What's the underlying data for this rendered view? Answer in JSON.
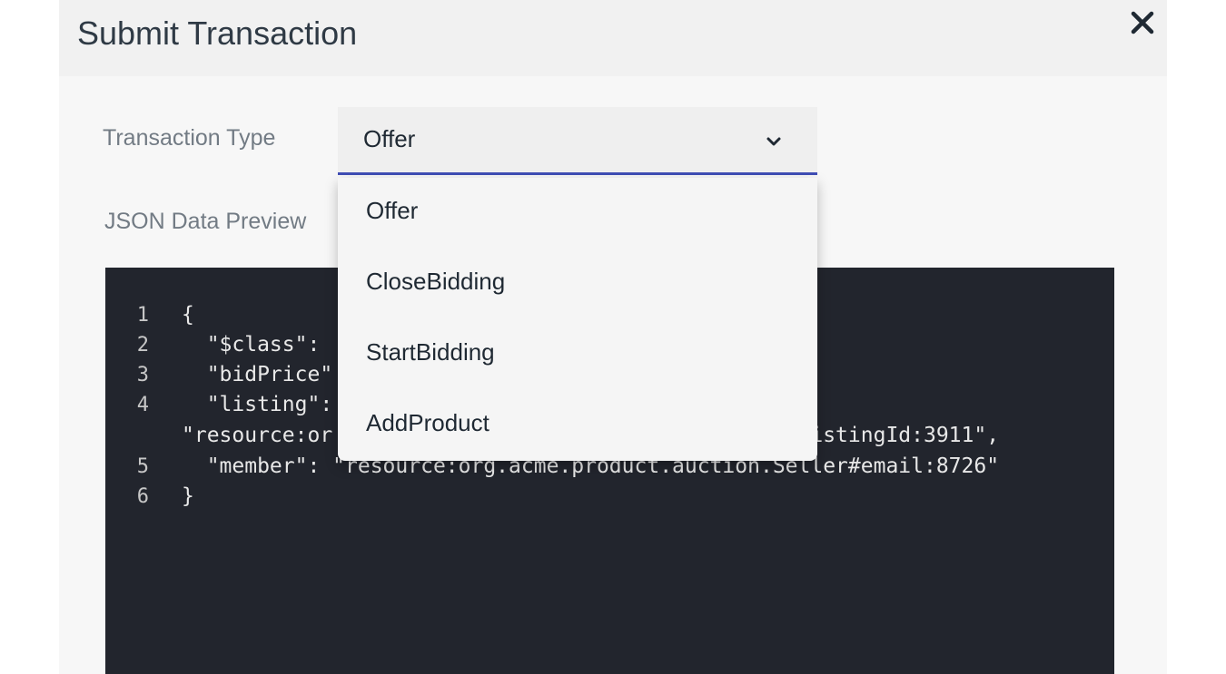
{
  "modal": {
    "title": "Submit Transaction",
    "close_icon": "close-icon"
  },
  "form": {
    "transaction_type_label": "Transaction Type",
    "selected_type": "Offer",
    "json_preview_label": "JSON Data Preview"
  },
  "dropdown": {
    "options": [
      "Offer",
      "CloseBidding",
      "StartBidding",
      "AddProduct"
    ]
  },
  "code": {
    "line_numbers": [
      "1",
      "2",
      "3",
      "4",
      "5",
      "6"
    ],
    "lines": [
      "{",
      "  \"$class\": ",
      "  \"bidPrice\"",
      "  \"listing\": ",
      "\"resource:or                                  ng#listingId:3911\",",
      "  \"member\": \"resource:org.acme.product.auction.Seller#email:8726\"",
      "}"
    ]
  },
  "colors": {
    "accent": "#3f4db5",
    "code_background": "#22252d"
  }
}
